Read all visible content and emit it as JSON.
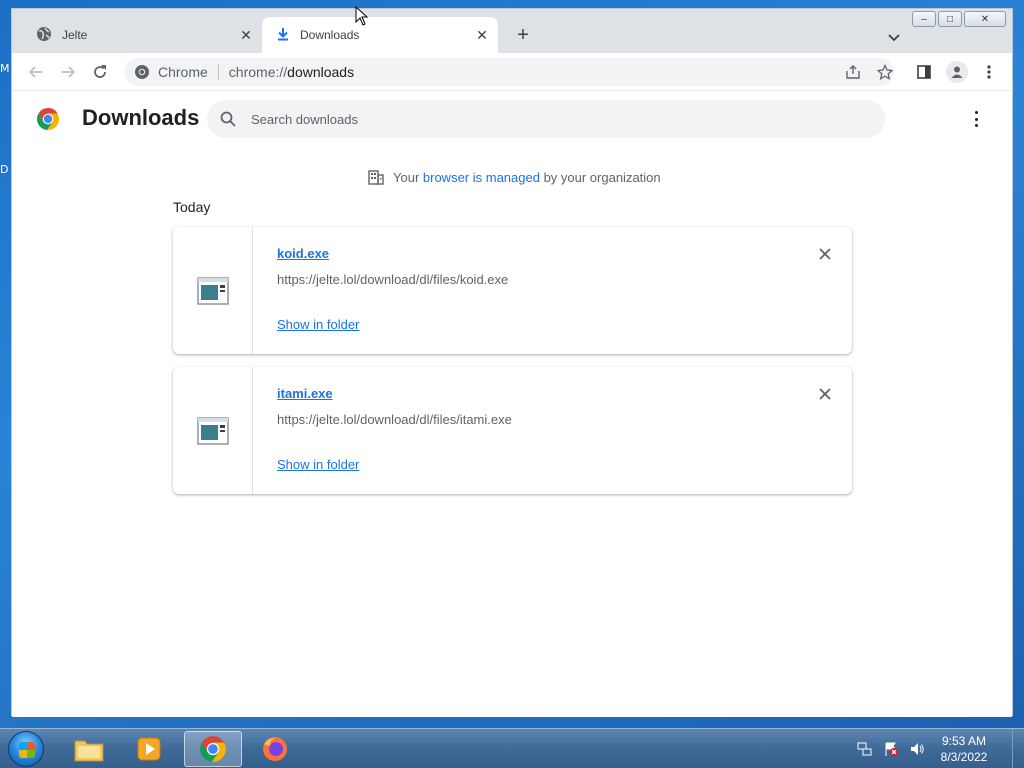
{
  "desktop": {
    "edge_text_top": "M",
    "edge_text_mid": "D"
  },
  "tabs": [
    {
      "title": "Jelte",
      "close": "✕"
    },
    {
      "title": "Downloads",
      "close": "✕"
    }
  ],
  "new_tab_label": "+",
  "window_controls": {
    "minimize": "–",
    "maximize": "□",
    "close": "✕"
  },
  "omnibox": {
    "chip_label": "Chrome",
    "url_scheme": "chrome://",
    "url_host": "downloads"
  },
  "page": {
    "title": "Downloads",
    "search_placeholder": "Search downloads",
    "managed_prefix": "Your ",
    "managed_link": "browser is managed",
    "managed_suffix": " by your organization",
    "section_label": "Today"
  },
  "downloads": [
    {
      "name": "koid.exe",
      "url": "https://jelte.lol/download/dl/files/koid.exe",
      "action": "Show in folder"
    },
    {
      "name": "itami.exe",
      "url": "https://jelte.lol/download/dl/files/itami.exe",
      "action": "Show in folder"
    }
  ],
  "taskbar": {
    "time": "9:53 AM",
    "date": "8/3/2022"
  },
  "colors": {
    "accent": "#1a73e8",
    "tabstrip": "#dee1e6",
    "omnibox": "#f1f3f4"
  },
  "icons": [
    "globe-icon",
    "download-icon",
    "back-icon",
    "forward-icon",
    "reload-icon",
    "share-icon",
    "star-icon",
    "side-panel-icon",
    "profile-icon",
    "menu-icon",
    "search-icon",
    "building-icon",
    "exe-file-icon",
    "close-icon"
  ]
}
